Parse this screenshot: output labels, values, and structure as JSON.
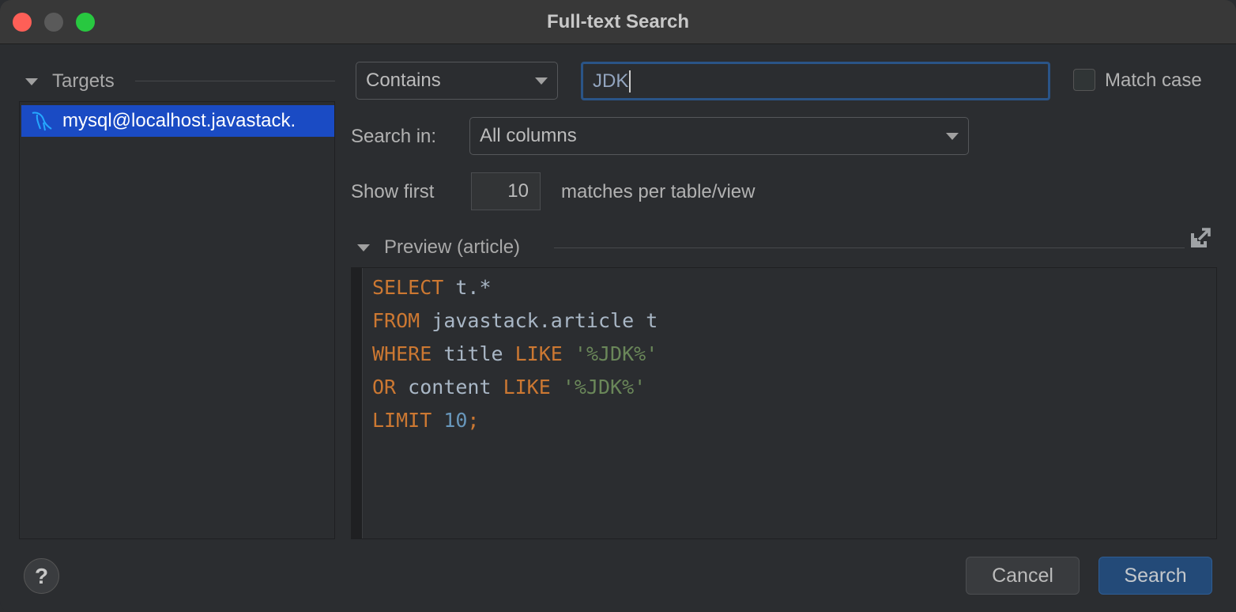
{
  "window": {
    "title": "Full-text Search",
    "traffic_lights": {
      "close": "#fe5f57",
      "minimize": "#5a5a5a",
      "maximize": "#28c840"
    }
  },
  "targets": {
    "header": "Targets",
    "items": [
      {
        "label": "mysql@localhost.javastack.",
        "icon": "mysql-dolphin-icon",
        "selected": true
      }
    ]
  },
  "search": {
    "mode": "Contains",
    "query": "JDK",
    "match_case_label": "Match case",
    "match_case": false,
    "search_in_label": "Search in:",
    "search_in_value": "All columns",
    "show_first_label": "Show first",
    "show_first_value": "10",
    "per_table_label": "matches per table/view"
  },
  "preview": {
    "header": "Preview (article)",
    "lines": [
      [
        {
          "t": "SELECT",
          "c": "kw"
        },
        {
          "t": " t.*",
          "c": "id"
        }
      ],
      [
        {
          "t": "FROM",
          "c": "kw"
        },
        {
          "t": " javastack.article t",
          "c": "id"
        }
      ],
      [
        {
          "t": "WHERE",
          "c": "kw"
        },
        {
          "t": " title ",
          "c": "id"
        },
        {
          "t": "LIKE",
          "c": "kw"
        },
        {
          "t": " '%JDK%'",
          "c": "str"
        }
      ],
      [
        {
          "t": "OR",
          "c": "kw"
        },
        {
          "t": " content ",
          "c": "id"
        },
        {
          "t": "LIKE",
          "c": "kw"
        },
        {
          "t": " '%JDK%'",
          "c": "str"
        }
      ],
      [
        {
          "t": "LIMIT",
          "c": "kw"
        },
        {
          "t": " 10",
          "c": "nm"
        },
        {
          "t": ";",
          "c": "kw"
        }
      ]
    ]
  },
  "footer": {
    "help": "?",
    "cancel": "Cancel",
    "search": "Search"
  },
  "colors": {
    "selection": "#1a4bc4",
    "primary_button": "#234a78",
    "keyword": "#cc7832",
    "string": "#6a8759",
    "number": "#6897bb"
  }
}
